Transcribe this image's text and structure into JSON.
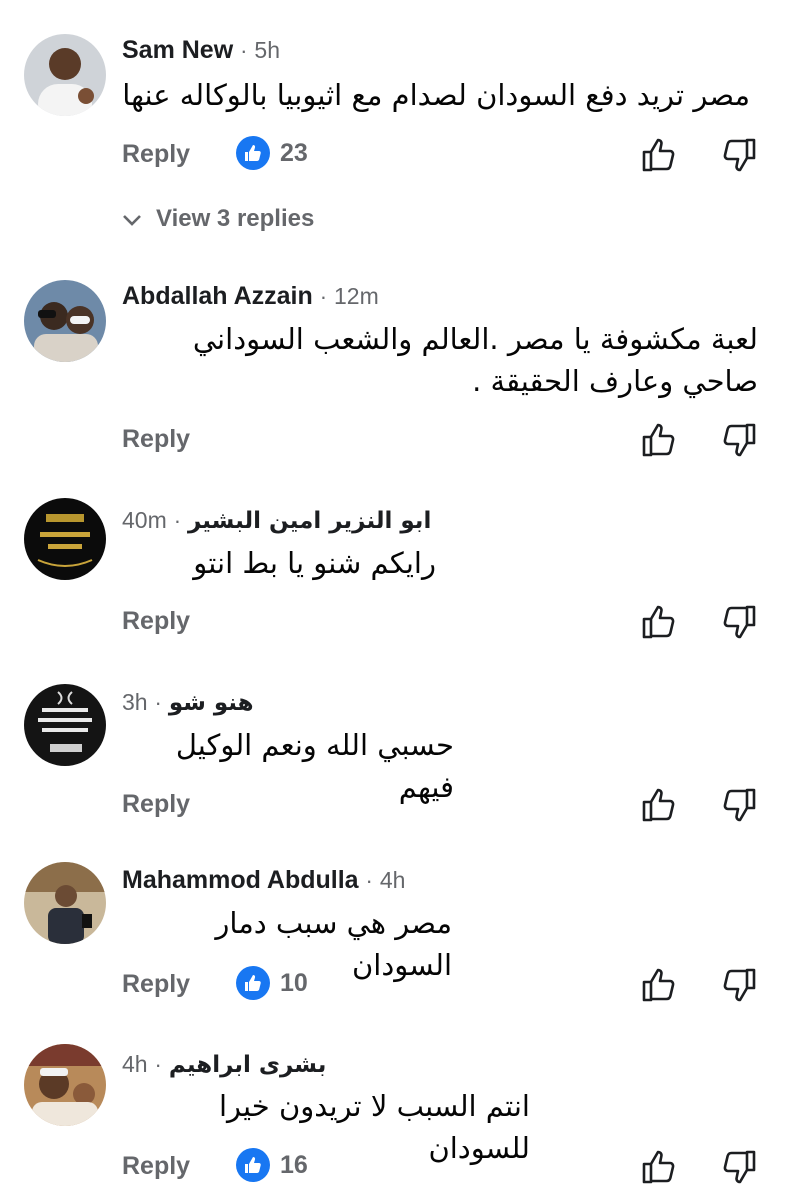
{
  "comments": [
    {
      "author": "Sam New",
      "time": "5h",
      "text": "مصر تريد دفع السودان لصدام مع اثيوبيا بالوكاله عنها",
      "reply_label": "Reply",
      "likes": "23",
      "view_replies": "View 3 replies"
    },
    {
      "author": "Abdallah Azzain",
      "time": "12m",
      "text": "لعبة مكشوفة يا مصر .العالم والشعب السوداني صاحي وعارف الحقيقة .",
      "reply_label": "Reply"
    },
    {
      "author": "ابو النزير امين البشير",
      "time": "40m",
      "text": "رايكم شنو يا بط انتو",
      "reply_label": "Reply"
    },
    {
      "author": "هنو شو",
      "time": "3h",
      "text": "حسبي الله ونعم الوكيل فيهم",
      "reply_label": "Reply"
    },
    {
      "author": "Mahammod Abdulla",
      "time": "4h",
      "text": "مصر هي سبب دمار السودان",
      "reply_label": "Reply",
      "likes": "10"
    },
    {
      "author": "بشرى ابراهيم",
      "time": "4h",
      "text": "انتم السبب لا تريدون خيرا للسودان",
      "reply_label": "Reply",
      "likes": "16"
    }
  ],
  "separator": "·",
  "colors": {
    "like_blue": "#1877f2",
    "meta_gray": "#65676b",
    "text": "#050505"
  }
}
